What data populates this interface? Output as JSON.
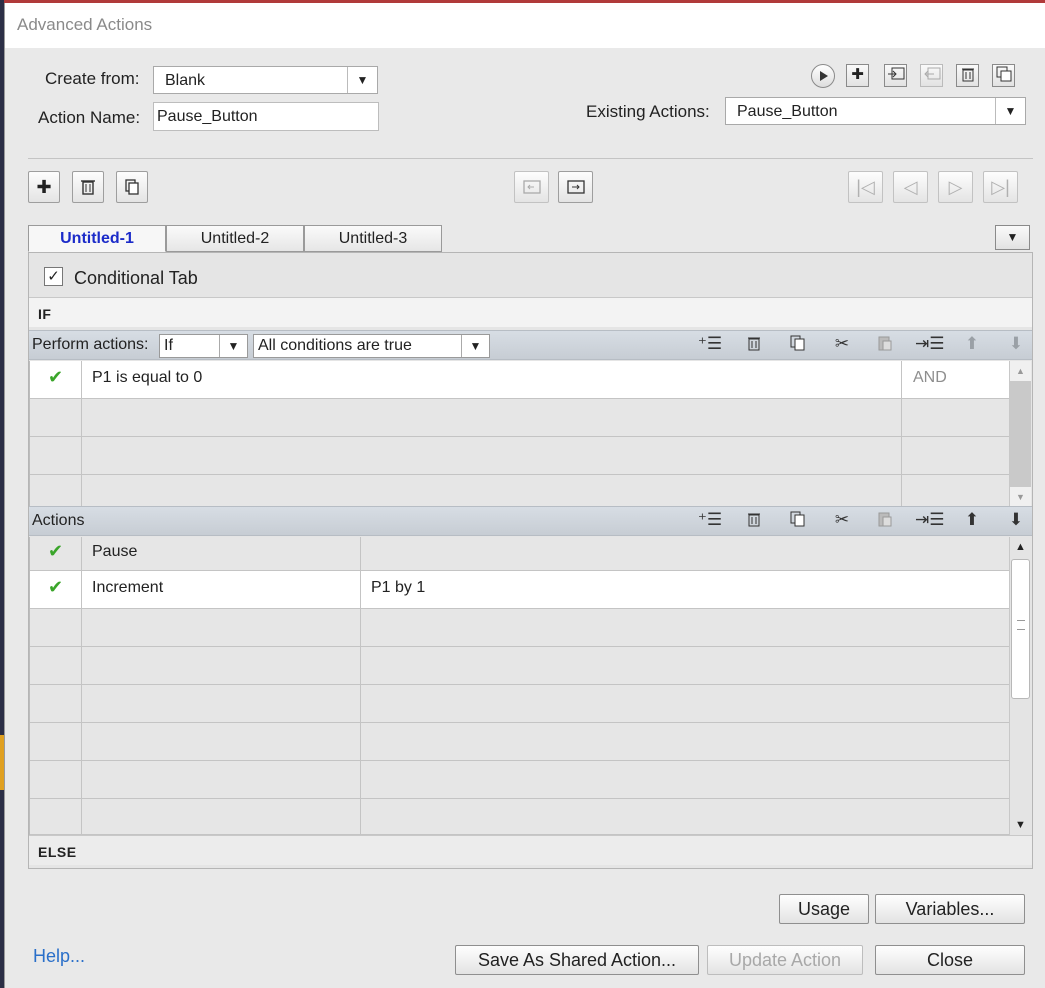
{
  "window": {
    "title": "Advanced Actions"
  },
  "form": {
    "create_from_label": "Create from:",
    "create_from_value": "Blank",
    "action_name_label": "Action Name:",
    "action_name_value": "Pause_Button",
    "existing_actions_label": "Existing Actions:",
    "existing_actions_value": "Pause_Button"
  },
  "tabs": [
    {
      "label": "Untitled-1",
      "active": true
    },
    {
      "label": "Untitled-2",
      "active": false
    },
    {
      "label": "Untitled-3",
      "active": false
    }
  ],
  "conditional_tab": {
    "label": "Conditional Tab",
    "checked": true
  },
  "if_section": {
    "header": "IF",
    "perform_actions_label": "Perform actions:",
    "perform_actions_value": "If",
    "conditions_value": "All conditions are true",
    "conditions": [
      {
        "checked": true,
        "text": "P1   is equal to    0",
        "operator": "AND"
      }
    ]
  },
  "actions_section": {
    "header": "Actions",
    "rows": [
      {
        "checked": true,
        "action": "Pause",
        "params": ""
      },
      {
        "checked": true,
        "action": "Increment",
        "params": "P1    by    1"
      }
    ]
  },
  "else_section": {
    "header": "ELSE"
  },
  "buttons": {
    "usage": "Usage",
    "variables": "Variables...",
    "save_shared": "Save As Shared Action...",
    "update_action": "Update Action",
    "close": "Close",
    "help": "Help..."
  },
  "icons": {
    "check": "✔",
    "checkbox_mark": "✓",
    "dropdown": "▼",
    "scroll_up": "▲",
    "scroll_down": "▼"
  },
  "colors": {
    "active_tab_text": "#1b2bc9",
    "check_green": "#3aa52a",
    "help_link": "#2a6fc9",
    "toolbar_row_bg": "#d0d6dd"
  }
}
